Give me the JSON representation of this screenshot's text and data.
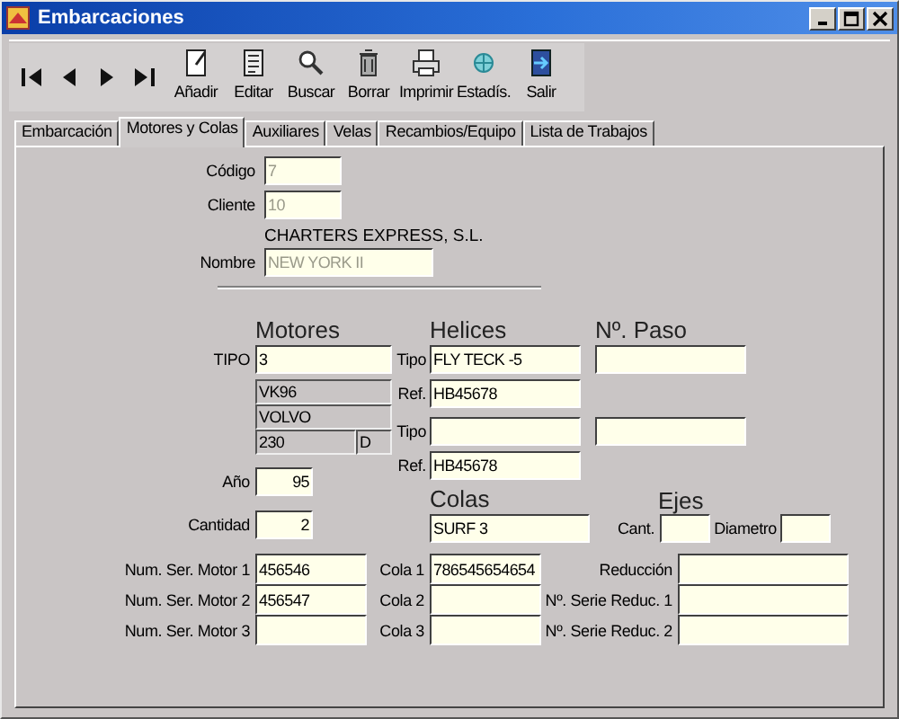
{
  "window": {
    "title": "Embarcaciones"
  },
  "toolbar": {
    "buttons": [
      {
        "label": "Añadir",
        "kind": "new"
      },
      {
        "label": "Editar",
        "kind": "edit"
      },
      {
        "label": "Buscar",
        "kind": "search"
      },
      {
        "label": "Borrar",
        "kind": "delete"
      },
      {
        "label": "Imprimir",
        "kind": "print"
      },
      {
        "label": "Estadís.",
        "kind": "stats"
      },
      {
        "label": "Salir",
        "kind": "exit"
      }
    ]
  },
  "tabs": [
    {
      "label": "Embarcación",
      "selected": false
    },
    {
      "label": "Motores y Colas",
      "selected": true
    },
    {
      "label": "Auxiliares",
      "selected": false
    },
    {
      "label": "Velas",
      "selected": false
    },
    {
      "label": "Recambios/Equipo",
      "selected": false
    },
    {
      "label": "Lista de Trabajos",
      "selected": false
    }
  ],
  "header": {
    "fields": [
      {
        "label": "Código",
        "value": "7",
        "disabled": true
      },
      {
        "label": "Cliente",
        "value": "10",
        "disabled": true
      }
    ],
    "client_name": "CHARTERS EXPRESS, S.L.",
    "name_field": {
      "label": "Nombre",
      "value": "NEW YORK II",
      "disabled": true
    }
  },
  "motores": {
    "heading": "Motores",
    "tipo": {
      "label": "TIPO",
      "value": "3"
    },
    "model": "VK96",
    "brand": "VOLVO",
    "power": "230",
    "fuel": "D",
    "anio": {
      "label": "Año",
      "value": "95"
    },
    "cantidad": {
      "label": "Cantidad",
      "value": "2"
    }
  },
  "helices": {
    "heading": "Helices",
    "paso_heading": "Nº. Paso",
    "rows": [
      {
        "tipo_label": "Tipo",
        "tipo": "FLY TECK -5",
        "ref_label": "Ref.",
        "ref": "HB45678"
      },
      {
        "tipo_label": "Tipo",
        "ref_label": "Ref.",
        "ref": "HB45678"
      }
    ]
  },
  "colas": {
    "heading": "Colas",
    "value": "SURF 3"
  },
  "ejes": {
    "heading": "Ejes",
    "cant_label": "Cant.",
    "diametro_label": "Diametro"
  },
  "series": [
    {
      "motor_label": "Num. Ser. Motor 1",
      "motor": "456546",
      "cola_label": "Cola 1",
      "cola": "786545654654",
      "reduc_label": "Reducción"
    },
    {
      "motor_label": "Num. Ser. Motor 2",
      "motor": "456547",
      "cola_label": "Cola 2",
      "reduc_label": "Nº. Serie Reduc. 1"
    },
    {
      "motor_label": "Num. Ser. Motor 3",
      "cola_label": "Cola 3",
      "reduc_label": "Nº. Serie Reduc. 2"
    }
  ]
}
